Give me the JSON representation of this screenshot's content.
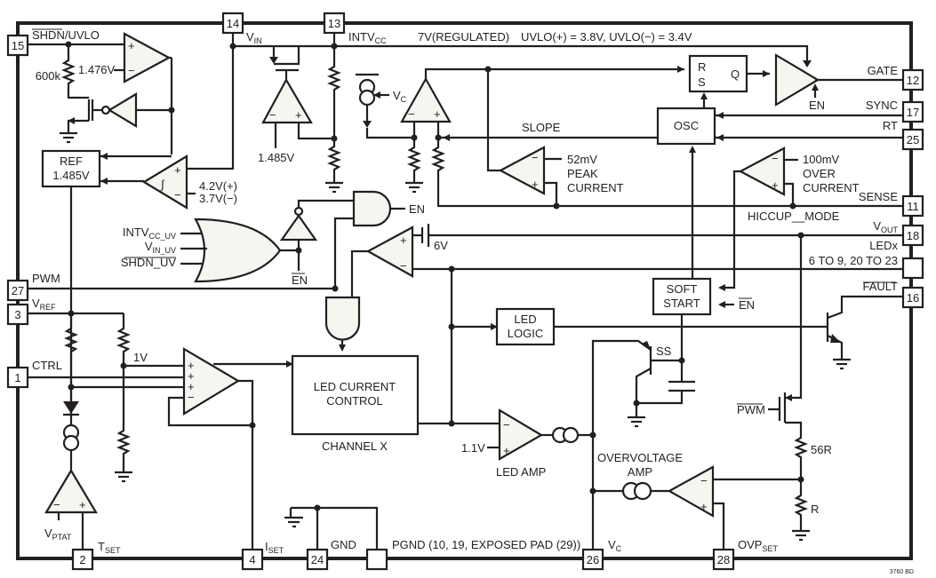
{
  "diagram": {
    "title_code": "3760 BD",
    "pins": {
      "p15": {
        "num": "15",
        "label": "SHDN/UVLO"
      },
      "p14": {
        "num": "14",
        "label_main": "V",
        "label_sub": "IN"
      },
      "p13": {
        "num": "13",
        "label_main": "INTV",
        "label_sub": "CC"
      },
      "p12": {
        "num": "12",
        "label": "GATE"
      },
      "p17": {
        "num": "17",
        "label": "SYNC"
      },
      "p25": {
        "num": "25",
        "label": "RT"
      },
      "p11": {
        "num": "11",
        "label": "SENSE"
      },
      "p18": {
        "num": "18",
        "label_main": "V",
        "label_sub": "OUT"
      },
      "pled": {
        "num": "",
        "label": "LEDx",
        "label2": "6 TO 9, 20 TO 23"
      },
      "p16": {
        "num": "16",
        "label": "FAULT"
      },
      "p27": {
        "num": "27",
        "label": "PWM"
      },
      "p3": {
        "num": "3",
        "label_main": "V",
        "label_sub": "REF"
      },
      "p1": {
        "num": "1",
        "label": "CTRL"
      },
      "p2": {
        "num": "2",
        "label_main": "T",
        "label_sub": "SET"
      },
      "p4": {
        "num": "4",
        "label_main": "I",
        "label_sub": "SET"
      },
      "p24": {
        "num": "24",
        "label": "GND"
      },
      "ppgnd": {
        "num": "",
        "label": "PGND (10, 19, EXPOSED PAD (29))"
      },
      "p26": {
        "num": "26",
        "label_main": "V",
        "label_sub": "C"
      },
      "p28": {
        "num": "28",
        "label_main": "OVP",
        "label_sub": "SET"
      }
    },
    "annotations": {
      "regulated": "7V(REGULATED)",
      "uvlo": "UVLO(+) = 3.8V, UVLO(−) = 3.4V",
      "r600k": "600k",
      "v1476": "1.476V",
      "ref_line1": "REF",
      "ref_line2": "1.485V",
      "v1485": "1.485V",
      "hyst_plus": "4.2V(+)",
      "hyst_minus": "3.7V(−)",
      "vc": "V",
      "vc_sub": "C",
      "slope": "SLOPE",
      "peak_1": "52mV",
      "peak_2": "PEAK",
      "peak_3": "CURRENT",
      "oc_1": "100mV",
      "oc_2": "OVER",
      "oc_3": "CURRENT",
      "hiccup": "HICCUP__MODE",
      "rs_r": "R",
      "rs_s": "S",
      "rs_q": "Q",
      "osc": "OSC",
      "en": "EN",
      "en_bar": "EN",
      "or_in1_main": "INTV",
      "or_in1_sub": "CC_UV",
      "or_in2_main": "V",
      "or_in2_sub": "IN_UV",
      "or_in3": "SHDN_UV",
      "v6": "6V",
      "soft_1": "SOFT",
      "soft_2": "START",
      "led_logic_1": "LED",
      "led_logic_2": "LOGIC",
      "lcc_1": "LED CURRENT",
      "lcc_2": "CONTROL",
      "channel": "CHANNEL X",
      "v1": "1V",
      "v11": "1.1V",
      "led_amp": "LED AMP",
      "ss": "SS",
      "pwm_bar": "PWM",
      "r56": "56R",
      "r": "R",
      "ov_1": "OVERVOLTAGE",
      "ov_2": "AMP",
      "vptat_main": "V",
      "vptat_sub": "PTAT",
      "plus": "+",
      "minus": "−"
    }
  }
}
